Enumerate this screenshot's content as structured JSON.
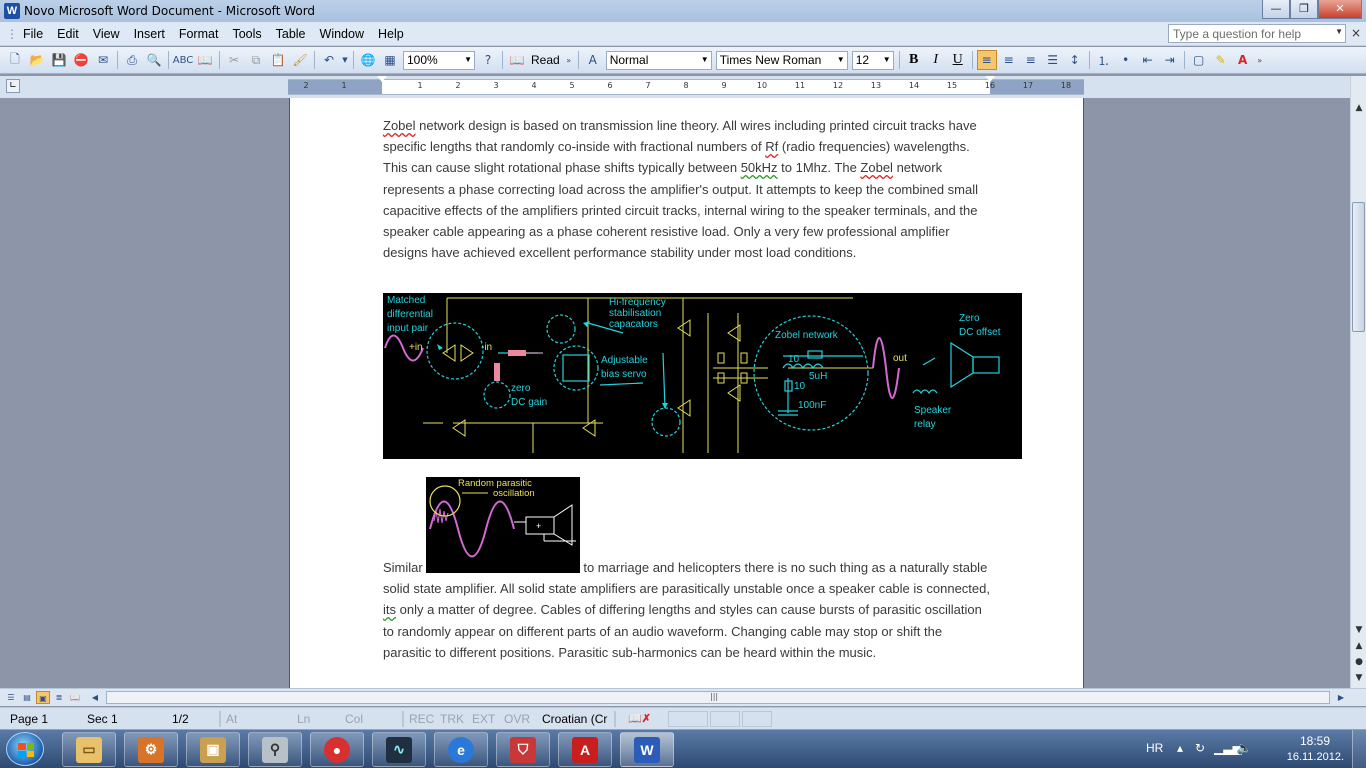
{
  "window": {
    "title": "Novo Microsoft Word Document - Microsoft Word",
    "app_icon_letter": "W",
    "minimize": "—",
    "maximize": "❐",
    "close": "✕"
  },
  "menu": {
    "items": [
      "File",
      "Edit",
      "View",
      "Insert",
      "Format",
      "Tools",
      "Table",
      "Window",
      "Help"
    ],
    "help_placeholder": "Type a question for help",
    "close_doc": "×"
  },
  "toolbar": {
    "zoom": "100%",
    "read_label": "Read",
    "style": "Normal",
    "font": "Times New Roman",
    "size": "12",
    "bold": "B",
    "italic": "I",
    "underline": "U"
  },
  "ruler": {
    "ticks": [
      "2",
      "1",
      "1",
      "2",
      "3",
      "4",
      "5",
      "6",
      "7",
      "8",
      "9",
      "10",
      "11",
      "12",
      "13",
      "14",
      "15",
      "16",
      "17",
      "18"
    ]
  },
  "document": {
    "para1_segments": [
      {
        "t": "Zobel",
        "s": "sq"
      },
      {
        "t": " network design is based on transmission line theory. All wires including printed circuit tracks have specific lengths that randomly co-inside with fractional numbers of ",
        "s": ""
      },
      {
        "t": "Rf",
        "s": "sq"
      },
      {
        "t": " (radio frequencies) wavelengths. This can cause slight rotational phase shifts typically between ",
        "s": ""
      },
      {
        "t": "50kHz",
        "s": "sq-g"
      },
      {
        "t": " to 1Mhz. The ",
        "s": ""
      },
      {
        "t": "Zobel",
        "s": "sq"
      },
      {
        "t": " network represents a phase correcting load across the amplifier's output. It attempts to keep the combined small capacitive effects of the amplifiers printed circuit tracks, internal wiring to the speaker terminals, and the speaker cable appearing as a phase coherent resistive load. Only a very few professional amplifier designs have achieved excellent performance stability under most load conditions.",
        "s": ""
      }
    ],
    "para2_lead": "Similar",
    "para2_after_image": " to marriage and helicopters there is no such thing as a naturally stable solid state amplifier. All solid state amplifiers are parasitically unstable once a speaker cable is connected, ",
    "para2_its": "its",
    "para2_rest": " only a matter of degree. Cables of differing lengths and styles can cause bursts of parasitic oscillation to randomly appear on different parts of an audio waveform. Changing cable may stop or shift the parasitic to different positions. Parasitic sub-harmonics can be heard within the music.",
    "figure_main": {
      "labels": {
        "matched": [
          "Matched",
          "differential",
          "input pair"
        ],
        "in_plus": "+in",
        "in_minus": "-in",
        "zero_dc": [
          "zero",
          "DC gain"
        ],
        "hifreq": [
          "Hi-frequency",
          "stabilisation",
          "capacators"
        ],
        "bias": [
          "Adjustable",
          "bias servo"
        ],
        "zobel": "Zobel network",
        "r10a": "10",
        "l5uh": "5uH",
        "r10b": "10",
        "c100nf": "100nF",
        "out": "out",
        "zero_offset": [
          "Zero",
          "DC offset"
        ],
        "relay": [
          "Speaker",
          "relay"
        ]
      }
    },
    "figure_small": {
      "labels": [
        "Random  parasitic",
        "oscillation"
      ]
    }
  },
  "statusbar": {
    "page": "Page  1",
    "sec": "Sec  1",
    "pages": "1/2",
    "at": "At",
    "ln": "Ln",
    "col": "Col",
    "rec": "REC",
    "trk": "TRK",
    "ext": "EXT",
    "ovr": "OVR",
    "language": "Croatian (Cr"
  },
  "taskbar": {
    "lang": "HR",
    "time": "18:59",
    "date": "16.11.2012."
  },
  "colors": {
    "figure_cyan": "#22d3dd",
    "figure_yellow": "#e8e05a",
    "figure_magenta": "#d26ad2",
    "figure_pink": "#e88aa0",
    "squiggle_red": "#dd2222",
    "squiggle_green": "#2a9a2a"
  }
}
